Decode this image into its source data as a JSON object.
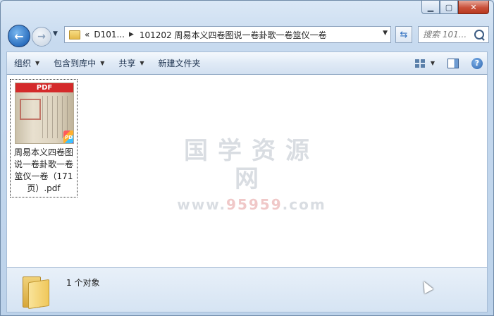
{
  "window": {
    "caption_buttons": [
      "minimize",
      "maximize",
      "close"
    ]
  },
  "nav": {
    "address": {
      "overflow": "«",
      "segments": [
        "D101...",
        "101202 周易本义四卷图说一卷卦歌一卷筮仪一卷"
      ]
    },
    "search": {
      "placeholder": "搜索 101..."
    }
  },
  "toolbar": {
    "organize": "组织",
    "include_in_library": "包含到库中",
    "share": "共享",
    "new_folder": "新建文件夹"
  },
  "file": {
    "name": "周易本义四卷图说一卷卦歌一卷筮仪一卷（171页）.pdf",
    "thumb_banner": "PDF",
    "badge": "PDF"
  },
  "watermark": {
    "title": "国学资源网",
    "url_prefix": "www.",
    "url_number": "95959",
    "url_suffix": ".com"
  },
  "status": {
    "count_text": "1 个对象"
  },
  "colors": {
    "accent": "#2b6fbf",
    "thumb_banner": "#d42a2a",
    "close_button": "#c9503a"
  }
}
